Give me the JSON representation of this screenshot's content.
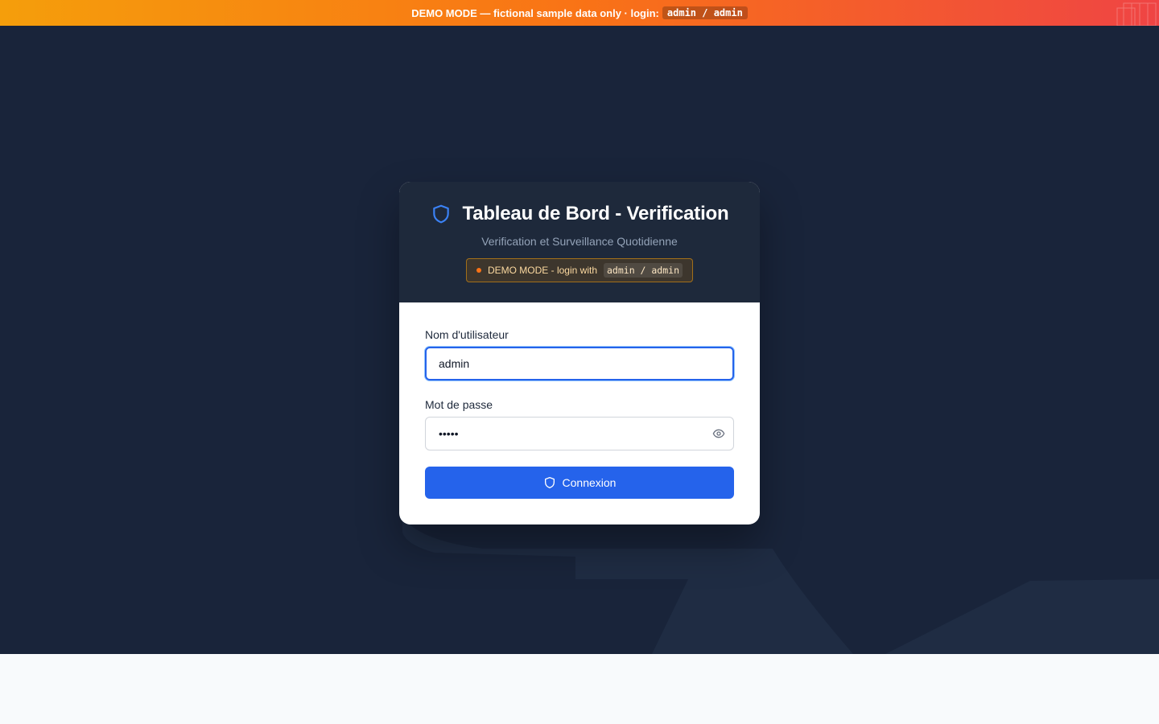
{
  "banner": {
    "text": "DEMO MODE — fictional sample data only · login:",
    "credentials": "admin / admin"
  },
  "login": {
    "title": "Tableau de Bord - Verification",
    "subtitle": "Verification et Surveillance Quotidienne",
    "demo_notice": "DEMO MODE - login with",
    "demo_credentials": "admin / admin",
    "username_label": "Nom d'utilisateur",
    "username_value": "admin",
    "password_label": "Mot de passe",
    "password_value": "admin",
    "submit_label": "Connexion"
  },
  "icons": {
    "title_icon": "shield-icon",
    "toggle_icon": "eye-icon",
    "submit_icon": "shield-icon"
  },
  "colors": {
    "accent": "#2563eb",
    "header_bg": "#1e293b",
    "page_bg": "#19243a",
    "banner_start": "#f59e0b",
    "banner_end": "#ef4444"
  }
}
